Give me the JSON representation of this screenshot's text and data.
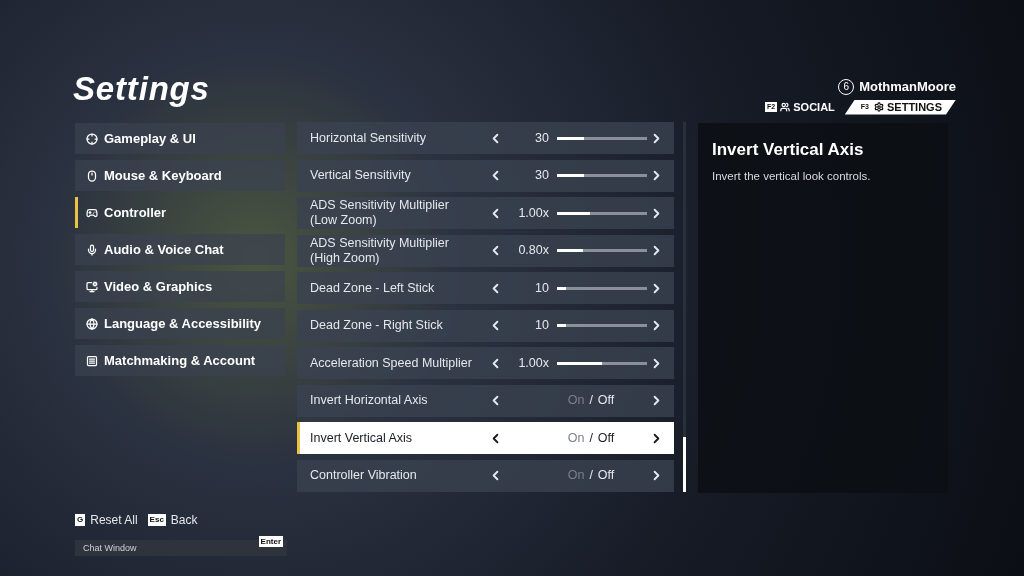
{
  "title": "Settings",
  "user": {
    "level": "6",
    "name": "MothmanMoore"
  },
  "tabs": [
    {
      "key": "F2",
      "label": "SOCIAL",
      "selected": false
    },
    {
      "key": "F3",
      "label": "SETTINGS",
      "selected": true
    }
  ],
  "sidebar": {
    "items": [
      {
        "label": "Gameplay & UI",
        "selected": false
      },
      {
        "label": "Mouse & Keyboard",
        "selected": false
      },
      {
        "label": "Controller",
        "selected": true
      },
      {
        "label": "Audio & Voice Chat",
        "selected": false
      },
      {
        "label": "Video & Graphics",
        "selected": false
      },
      {
        "label": "Language & Accessibility",
        "selected": false
      },
      {
        "label": "Matchmaking & Account",
        "selected": false
      }
    ]
  },
  "settings": [
    {
      "kind": "slider",
      "label": "Horizontal Sensitivity",
      "value": "30",
      "level": 0.3,
      "selected": false
    },
    {
      "kind": "slider",
      "label": "Vertical Sensitivity",
      "value": "30",
      "level": 0.3,
      "selected": false
    },
    {
      "kind": "slider",
      "label": "ADS Sensitivity Multiplier (Low Zoom)",
      "value": "1.00x",
      "level": 0.37,
      "selected": false
    },
    {
      "kind": "slider",
      "label": "ADS Sensitivity Multiplier (High Zoom)",
      "value": "0.80x",
      "level": 0.29,
      "selected": false
    },
    {
      "kind": "slider",
      "label": "Dead Zone - Left Stick",
      "value": "10",
      "level": 0.1,
      "selected": false
    },
    {
      "kind": "slider",
      "label": "Dead Zone - Right Stick",
      "value": "10",
      "level": 0.1,
      "selected": false
    },
    {
      "kind": "slider",
      "label": "Acceleration Speed Multiplier",
      "value": "1.00x",
      "level": 0.5,
      "selected": false
    },
    {
      "kind": "toggle",
      "label": "Invert Horizontal Axis",
      "on_label": "On",
      "separator": "/",
      "off_label": "Off",
      "on": false,
      "selected": false
    },
    {
      "kind": "toggle",
      "label": "Invert Vertical Axis",
      "on_label": "On",
      "separator": "/",
      "off_label": "Off",
      "on": false,
      "selected": true
    },
    {
      "kind": "toggle",
      "label": "Controller Vibration",
      "on_label": "On",
      "separator": "/",
      "off_label": "Off",
      "on": false,
      "selected": false
    }
  ],
  "detail": {
    "title": "Invert Vertical Axis",
    "description": "Invert the vertical look controls."
  },
  "footer": {
    "actions": [
      {
        "key": "G",
        "label": "Reset All"
      },
      {
        "key": "Esc",
        "label": "Back"
      }
    ],
    "chat": {
      "placeholder": "Chat Window",
      "key": "Enter"
    }
  }
}
